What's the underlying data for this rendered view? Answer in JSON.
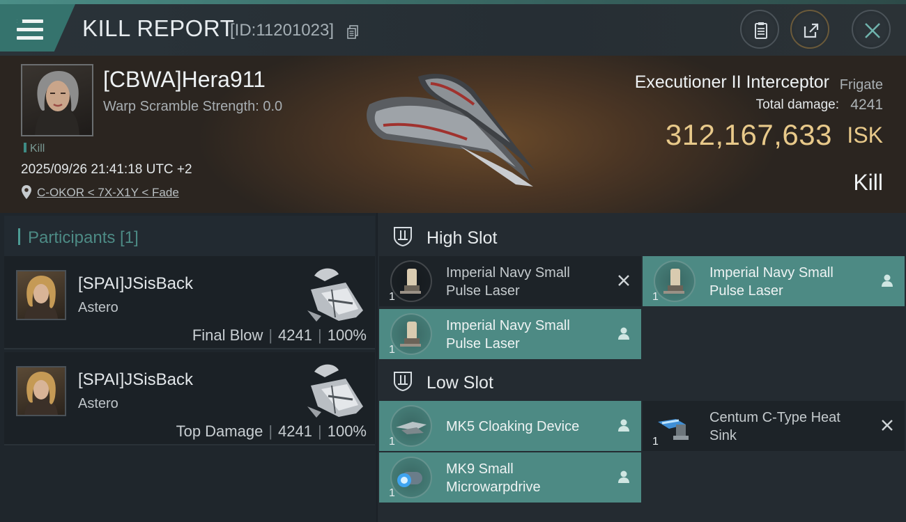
{
  "header": {
    "title": "KILL REPORT",
    "report_id": "[ID:11201023]",
    "icons": [
      "menu-icon",
      "copy-icon",
      "clipboard-icon",
      "share-icon",
      "close-icon"
    ]
  },
  "victim": {
    "name": "[CBWA]Hera911",
    "warp_scramble": "Warp Scramble Strength: 0.0",
    "tag": "Kill",
    "datetime": "2025/09/26 21:41:18 UTC +2",
    "location": "C-OKOR < 7X-X1Y < Fade",
    "ship_type": "Executioner II Interceptor",
    "ship_class": "Frigate",
    "total_damage_label": "Total damage:",
    "total_damage": "4241",
    "isk_value": "312,167,633",
    "isk_unit": "ISK",
    "result": "Kill"
  },
  "participants": {
    "title": "Participants [1]",
    "rows": [
      {
        "name": "[SPAI]JSisBack",
        "ship": "Astero",
        "role": "Final Blow",
        "damage": "4241",
        "percent": "100%"
      },
      {
        "name": "[SPAI]JSisBack",
        "ship": "Astero",
        "role": "Top Damage",
        "damage": "4241",
        "percent": "100%"
      }
    ]
  },
  "fitting": {
    "high_slot": {
      "label": "High Slot",
      "modules": [
        {
          "name": "Imperial Navy Small Pulse Laser",
          "qty": "1",
          "state": "destroyed"
        },
        {
          "name": "Imperial Navy Small Pulse Laser",
          "qty": "1",
          "state": "dropped"
        },
        {
          "name": "Imperial Navy Small Pulse Laser",
          "qty": "1",
          "state": "dropped"
        }
      ]
    },
    "low_slot": {
      "label": "Low Slot",
      "modules": [
        {
          "name": "MK5 Cloaking Device",
          "qty": "1",
          "state": "dropped"
        },
        {
          "name": "Centum C-Type Heat Sink",
          "qty": "1",
          "state": "destroyed"
        },
        {
          "name": "MK9 Small Microwarpdrive",
          "qty": "1",
          "state": "dropped"
        }
      ]
    }
  },
  "colors": {
    "accent": "#4d8a84",
    "isk": "#e8c98a",
    "background": "#1b2127"
  }
}
